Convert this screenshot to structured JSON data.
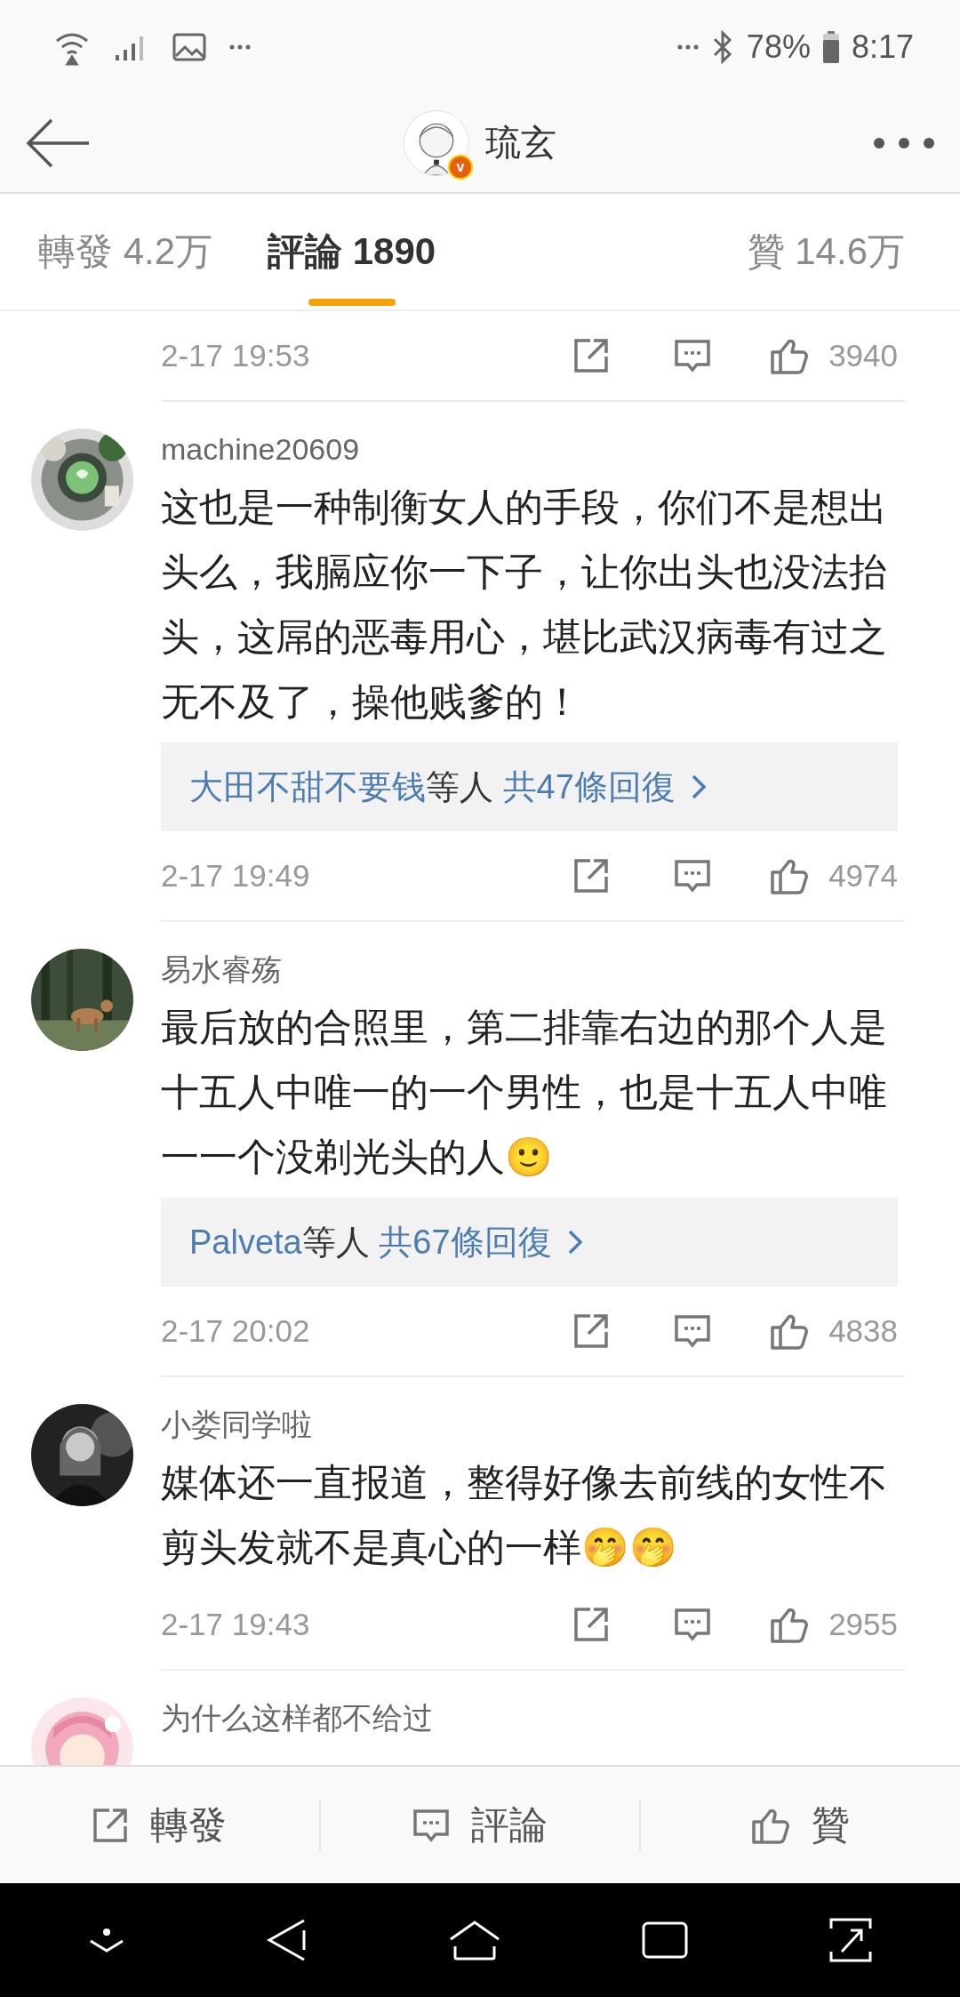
{
  "status_bar": {
    "battery": "78%",
    "time": "8:17"
  },
  "header": {
    "badge": "v",
    "title": "琉玄"
  },
  "tabs": [
    {
      "label": "轉發 4.2万",
      "selected": false
    },
    {
      "label": "評論 1890",
      "selected": true
    },
    {
      "label": "贊 14.6万",
      "selected": false
    }
  ],
  "comments": [
    {
      "date": "2-17 19:53",
      "likes": "3940"
    },
    {
      "name": "machine20609",
      "text": "这也是一种制衡女人的手段，你们不是想出头么，我膈应你一下子，让你出头也没法抬头，这屌的恶毒用心，堪比武汉病毒有过之无不及了，操他贱爹的！",
      "replies": {
        "names": "大田不甜不要钱",
        "suffix": "等人",
        "total": "共47條回復"
      },
      "date": "2-17 19:49",
      "likes": "4974"
    },
    {
      "name": "易水睿殇",
      "text": "最后放的合照里，第二排靠右边的那个人是十五人中唯一的一个男性，也是十五人中唯一一个没剃光头的人🙂",
      "replies": {
        "names": "Palveta",
        "suffix": "等人",
        "total": "共67條回復"
      },
      "date": "2-17 20:02",
      "likes": "4838"
    },
    {
      "name": "小娄同学啦",
      "text": "媒体还一直报道，整得好像去前线的女性不剪头发就不是真心的一样🤭🤭",
      "date": "2-17 19:43",
      "likes": "2955"
    },
    {
      "name": "为什么这样都不给过"
    }
  ],
  "action_bar": [
    {
      "kind": "repost",
      "label": "轉發"
    },
    {
      "kind": "comment",
      "label": "評論"
    },
    {
      "kind": "like",
      "label": "贊"
    }
  ]
}
